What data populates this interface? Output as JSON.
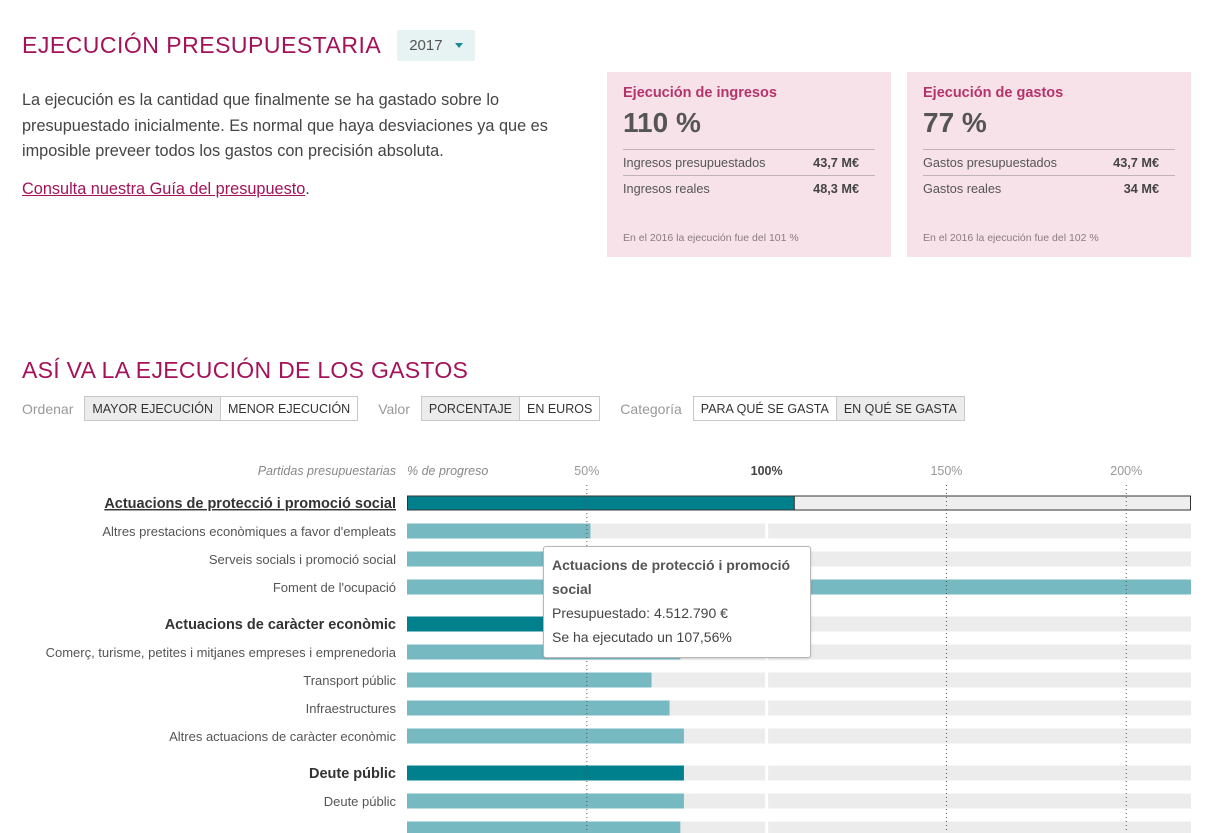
{
  "header": {
    "title": "EJECUCIÓN PRESUPUESTARIA",
    "year": "2017",
    "year_icon": "chevron-down-icon"
  },
  "intro": {
    "text": "La ejecución es la cantidad que finalmente se ha gastado sobre lo presupuestado inicialmente. Es normal que haya desviaciones ya que es imposible preveer todos los gastos con precisión absoluta.",
    "link_text": "Consulta nuestra Guía del presupuesto",
    "link_suffix": "."
  },
  "cards": {
    "income": {
      "label": "Ejecución de ingresos",
      "value": "110 %",
      "rows": [
        {
          "label": "Ingresos presupuestados",
          "value": "43,7 M€"
        },
        {
          "label": "Ingresos reales",
          "value": "48,3 M€"
        }
      ],
      "note": "En el 2016 la ejecución fue del 101 %"
    },
    "expense": {
      "label": "Ejecución de gastos",
      "value": "77 %",
      "rows": [
        {
          "label": "Gastos presupuestados",
          "value": "43,7 M€"
        },
        {
          "label": "Gastos reales",
          "value": "34 M€"
        }
      ],
      "note": "En el 2016 la ejecución fue del 102 %"
    }
  },
  "section": {
    "title": "ASÍ VA LA EJECUCIÓN DE LOS GASTOS"
  },
  "controls": {
    "order_label": "Ordenar",
    "order_options": [
      "MAYOR EJECUCIÓN",
      "MENOR EJECUCIÓN"
    ],
    "order_selected": "MAYOR EJECUCIÓN",
    "value_label": "Valor",
    "value_options": [
      "PORCENTAJE",
      "EN EUROS"
    ],
    "value_selected": "PORCENTAJE",
    "category_label": "Categoría",
    "category_options": [
      "PARA QUÉ SE GASTA",
      "EN QUÉ SE GASTA"
    ],
    "category_selected": "EN QUÉ SE GASTA"
  },
  "tooltip": {
    "title": "Actuacions de protecció i promoció social",
    "budget": "Presupuestado: 4.512.790 €",
    "executed": "Se ha ejecutado un 107,56%"
  },
  "colors": {
    "accent": "#a4125a",
    "group_bar": "#00808c",
    "item_bar": "#77b9c0",
    "track": "#ececec",
    "card_bg": "#f7e2ea"
  },
  "chart_data": {
    "type": "bar",
    "orientation": "horizontal",
    "row_header": "Partidas presupuestarias",
    "axis_header": "% de progreso",
    "x_ticks": [
      {
        "value": 50,
        "label": "50%",
        "bold": false
      },
      {
        "value": 100,
        "label": "100%",
        "bold": true
      },
      {
        "value": 150,
        "label": "150%",
        "bold": false
      },
      {
        "value": 200,
        "label": "200%",
        "bold": false
      }
    ],
    "xlim": [
      0,
      218
    ],
    "rows": [
      {
        "label": "Actuacions de protecció i promoció social",
        "value": 107.56,
        "group": true,
        "highlight": true,
        "underline": true
      },
      {
        "label": "Altres prestacions econòmiques a favor d'empleats",
        "value": 51,
        "group": false
      },
      {
        "label": "Serveis socials i promoció social",
        "value": 62,
        "group": false
      },
      {
        "label": "Foment de l'ocupació",
        "value": 218,
        "group": false
      },
      {
        "label": "Actuacions de caràcter econòmic",
        "value": 78,
        "group": true
      },
      {
        "label": "Comerç, turisme, petites i mitjanes empreses i emprenedoria",
        "value": 76,
        "group": false
      },
      {
        "label": "Transport públic",
        "value": 68,
        "group": false
      },
      {
        "label": "Infraestructures",
        "value": 73,
        "group": false
      },
      {
        "label": "Altres actuacions de caràcter econòmic",
        "value": 77,
        "group": false
      },
      {
        "label": "Deute públic",
        "value": 77,
        "group": true
      },
      {
        "label": "Deute públic",
        "value": 77,
        "group": false
      },
      {
        "label": "",
        "value": 76,
        "group": false
      }
    ]
  }
}
